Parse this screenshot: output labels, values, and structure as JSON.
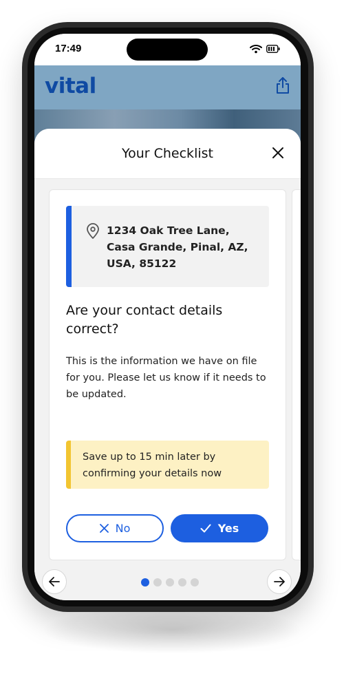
{
  "status_bar": {
    "time": "17:49"
  },
  "app": {
    "logo_text": "vital"
  },
  "sheet": {
    "title": "Your Checklist",
    "card": {
      "address": "1234 Oak Tree Lane, Casa Grande, Pinal, AZ, USA, 85122",
      "question": "Are your contact details correct?",
      "description": "This is the information we have on file for you. Please let us know if it needs to be updated.",
      "notice": "Save up to 15 min later by confirming your details now",
      "no_label": "No",
      "yes_label": "Yes"
    },
    "pagination": {
      "total": 5,
      "current": 1
    }
  },
  "colors": {
    "accent": "#1d5fe0",
    "header_bg": "#7fa6c3",
    "logo": "#0f4aa3",
    "notice_bg": "#fdf1c4",
    "notice_bar": "#f2c531"
  },
  "icons": [
    "wifi-icon",
    "battery-icon",
    "share-icon",
    "close-icon",
    "location-pin-icon",
    "x-icon",
    "check-icon",
    "arrow-left-icon",
    "arrow-right-icon"
  ]
}
